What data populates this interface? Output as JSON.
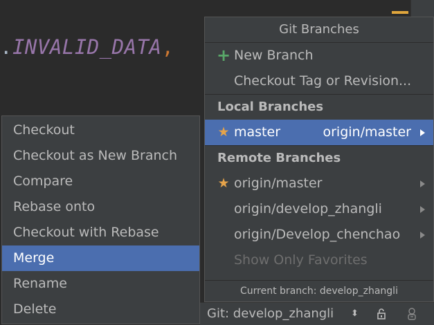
{
  "editor": {
    "code_prefix": ".",
    "code_identifier": "INVALID_DATA",
    "code_suffix": ","
  },
  "git_popup": {
    "title": "Git Branches",
    "actions": [
      {
        "label": "New Branch",
        "icon": "plus-icon"
      },
      {
        "label": "Checkout Tag or Revision..."
      }
    ],
    "local_header": "Local Branches",
    "local_branches": [
      {
        "label": "master",
        "tracking": "origin/master",
        "icon": "star-icon",
        "selected": true
      }
    ],
    "remote_header": "Remote Branches",
    "remote_branches": [
      {
        "label": "origin/master",
        "icon": "star-icon"
      },
      {
        "label": "origin/develop_zhangli"
      },
      {
        "label": "origin/Develop_chenchao"
      }
    ],
    "show_only_favorites": "Show Only Favorites",
    "footer": "Current branch: develop_zhangli"
  },
  "context_menu": {
    "items": [
      {
        "label": "Checkout"
      },
      {
        "label": "Checkout as New Branch"
      },
      {
        "label": "Compare"
      },
      {
        "label": "Rebase onto"
      },
      {
        "label": "Checkout with Rebase"
      },
      {
        "label": "Merge",
        "selected": true
      },
      {
        "label": "Rename"
      },
      {
        "label": "Delete"
      }
    ]
  },
  "status_bar": {
    "git_branch": "Git: develop_zhangli",
    "updown_glyph": "⬍",
    "lock_icon": "lock-icon",
    "inspector_icon": "hector-icon"
  },
  "colors": {
    "selection": "#4b6eaf",
    "star": "#e5a34a",
    "plus": "#59a869",
    "constant": "#9876aa"
  }
}
